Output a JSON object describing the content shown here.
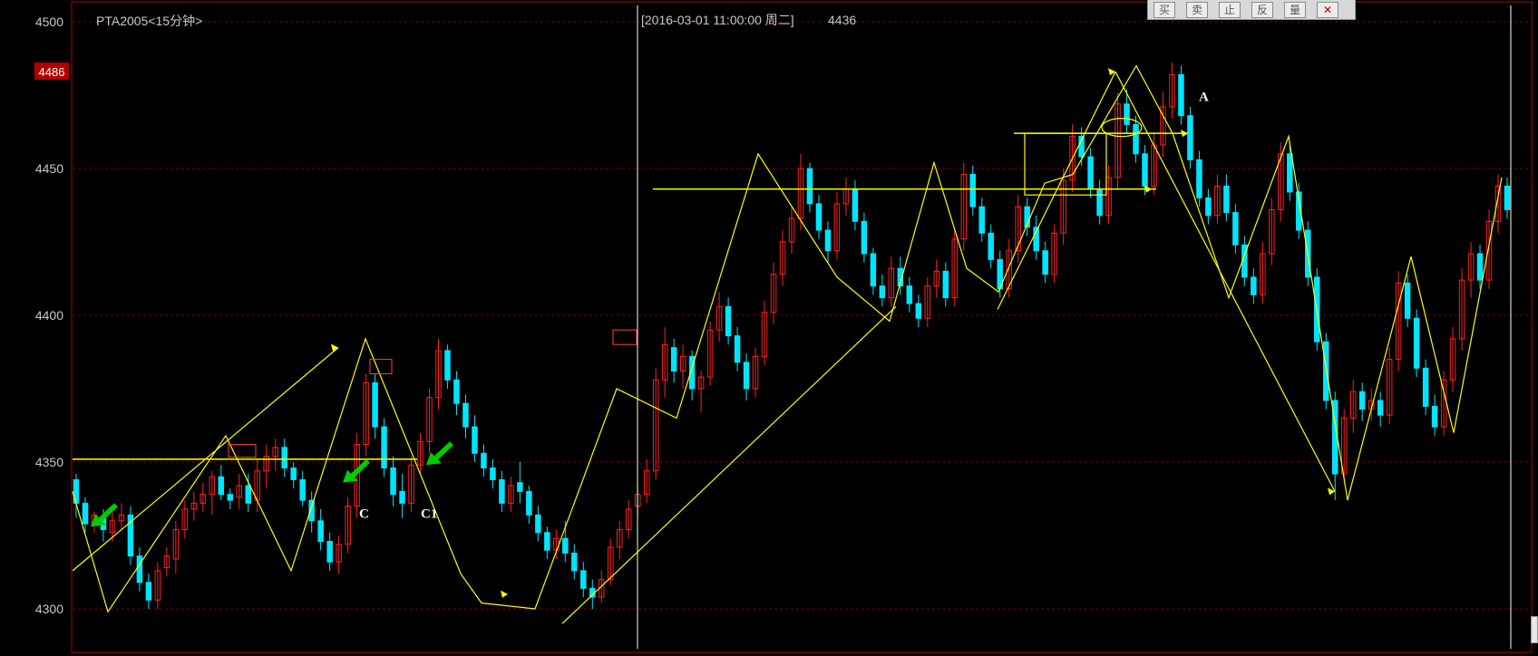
{
  "header": {
    "symbol": "PTA2005<15分钟>",
    "cursor_info": "[2016-03-01  11:00:00 周二]",
    "cursor_value": "4436"
  },
  "current_price_label": "4486",
  "toolbar": {
    "buttons": [
      "买",
      "卖",
      "止",
      "反",
      "量"
    ],
    "close_glyph": "✕"
  },
  "annotations": [
    {
      "text": "C",
      "x": 396,
      "price": 4331
    },
    {
      "text": "C1",
      "x": 464,
      "price": 4331
    },
    {
      "text": "A",
      "x": 1322,
      "price": 4473
    }
  ],
  "colors": {
    "up": "#ff2020",
    "down": "#00e5ff",
    "frame": "#b00000",
    "axis_text": "#c8c8c8",
    "trend": "#ffff00",
    "arrow_green": "#00cc00",
    "price_label_bg": "#b00000"
  },
  "chart_data": {
    "type": "candlestick",
    "title": "PTA2005<15分钟>",
    "ylim": [
      4285,
      4507
    ],
    "yticks": [
      "4500",
      "4450",
      "4400",
      "4350",
      "4300"
    ],
    "grid": "horizontal-dashed",
    "trend_zigzag": [
      [
        80,
        4340
      ],
      [
        119,
        4299
      ],
      [
        249,
        4359
      ],
      [
        321,
        4313
      ],
      [
        403,
        4392
      ],
      [
        508,
        4312
      ],
      [
        531,
        4302
      ],
      [
        590,
        4300
      ],
      [
        680,
        4375
      ],
      [
        746,
        4365
      ],
      [
        836,
        4455
      ],
      [
        923,
        4413
      ],
      [
        981,
        4398
      ],
      [
        1030,
        4452
      ],
      [
        1066,
        4416
      ],
      [
        1101,
        4408
      ],
      [
        1152,
        4445
      ],
      [
        1183,
        4448
      ],
      [
        1253,
        4485
      ],
      [
        1293,
        4462
      ],
      [
        1355,
        4406
      ],
      [
        1421,
        4461
      ],
      [
        1486,
        4337
      ],
      [
        1556,
        4420
      ],
      [
        1603,
        4360
      ],
      [
        1656,
        4447
      ]
    ],
    "support_lines": [
      {
        "from": [
          80,
          4351
        ],
        "to": [
          460,
          4351
        ]
      },
      {
        "from": [
          720,
          4443
        ],
        "to": [
          1275,
          4443
        ]
      },
      {
        "from": [
          1118,
          4462
        ],
        "to": [
          1310,
          4462
        ]
      }
    ],
    "ohlc": [
      [
        4344,
        4346,
        4331,
        4336
      ],
      [
        4336,
        4338,
        4326,
        4329
      ],
      [
        4329,
        4333,
        4326,
        4332
      ],
      [
        4331,
        4334,
        4323,
        4327
      ],
      [
        4326,
        4333,
        4323,
        4330
      ],
      [
        4330,
        4336,
        4327,
        4332
      ],
      [
        4332,
        4335,
        4315,
        4318
      ],
      [
        4318,
        4321,
        4306,
        4309
      ],
      [
        4309,
        4312,
        4300,
        4303
      ],
      [
        4303,
        4316,
        4300,
        4313
      ],
      [
        4314,
        4321,
        4311,
        4318
      ],
      [
        4317,
        4330,
        4312,
        4327
      ],
      [
        4327,
        4337,
        4324,
        4334
      ],
      [
        4334,
        4340,
        4330,
        4336
      ],
      [
        4336,
        4343,
        4333,
        4339
      ],
      [
        4339,
        4347,
        4332,
        4345
      ],
      [
        4345,
        4349,
        4337,
        4339
      ],
      [
        4339,
        4341,
        4334,
        4337
      ],
      [
        4338,
        4346,
        4334,
        4342
      ],
      [
        4342,
        4346,
        4333,
        4336
      ],
      [
        4337,
        4351,
        4333,
        4347
      ],
      [
        4347,
        4356,
        4341,
        4352
      ],
      [
        4352,
        4358,
        4347,
        4355
      ],
      [
        4355,
        4358,
        4345,
        4348
      ],
      [
        4348,
        4350,
        4341,
        4344
      ],
      [
        4344,
        4347,
        4335,
        4337
      ],
      [
        4337,
        4340,
        4326,
        4330
      ],
      [
        4330,
        4334,
        4320,
        4323
      ],
      [
        4323,
        4326,
        4313,
        4316
      ],
      [
        4316,
        4325,
        4312,
        4322
      ],
      [
        4322,
        4338,
        4319,
        4335
      ],
      [
        4335,
        4360,
        4331,
        4356
      ],
      [
        4356,
        4380,
        4352,
        4377
      ],
      [
        4377,
        4380,
        4358,
        4362
      ],
      [
        4362,
        4365,
        4345,
        4348
      ],
      [
        4348,
        4352,
        4335,
        4339
      ],
      [
        4340,
        4346,
        4331,
        4336
      ],
      [
        4336,
        4352,
        4333,
        4349
      ],
      [
        4349,
        4360,
        4346,
        4357
      ],
      [
        4357,
        4375,
        4353,
        4372
      ],
      [
        4372,
        4392,
        4368,
        4388
      ],
      [
        4388,
        4390,
        4375,
        4378
      ],
      [
        4378,
        4381,
        4366,
        4370
      ],
      [
        4370,
        4373,
        4358,
        4362
      ],
      [
        4362,
        4366,
        4350,
        4353
      ],
      [
        4353,
        4356,
        4345,
        4348
      ],
      [
        4348,
        4351,
        4341,
        4344
      ],
      [
        4344,
        4347,
        4333,
        4336
      ],
      [
        4336,
        4345,
        4333,
        4342
      ],
      [
        4343,
        4350,
        4336,
        4340
      ],
      [
        4340,
        4342,
        4329,
        4332
      ],
      [
        4332,
        4335,
        4323,
        4326
      ],
      [
        4326,
        4328,
        4317,
        4320
      ],
      [
        4320,
        4327,
        4317,
        4324
      ],
      [
        4324,
        4330,
        4316,
        4319
      ],
      [
        4319,
        4322,
        4310,
        4313
      ],
      [
        4313,
        4316,
        4304,
        4307
      ],
      [
        4307,
        4310,
        4300,
        4304
      ],
      [
        4304,
        4313,
        4302,
        4310
      ],
      [
        4310,
        4324,
        4308,
        4321
      ],
      [
        4321,
        4330,
        4317,
        4327
      ],
      [
        4327,
        4337,
        4324,
        4334
      ],
      [
        4335,
        4342,
        4331,
        4339
      ],
      [
        4339,
        4351,
        4336,
        4347
      ],
      [
        4347,
        4382,
        4344,
        4378
      ],
      [
        4378,
        4396,
        4372,
        4390
      ],
      [
        4389,
        4392,
        4377,
        4381
      ],
      [
        4381,
        4390,
        4375,
        4386
      ],
      [
        4386,
        4388,
        4371,
        4375
      ],
      [
        4375,
        4381,
        4367,
        4379
      ],
      [
        4379,
        4398,
        4376,
        4395
      ],
      [
        4395,
        4408,
        4391,
        4403
      ],
      [
        4403,
        4406,
        4390,
        4393
      ],
      [
        4393,
        4396,
        4381,
        4384
      ],
      [
        4384,
        4387,
        4371,
        4375
      ],
      [
        4375,
        4389,
        4372,
        4386
      ],
      [
        4386,
        4405,
        4383,
        4401
      ],
      [
        4401,
        4418,
        4397,
        4414
      ],
      [
        4414,
        4429,
        4410,
        4425
      ],
      [
        4425,
        4437,
        4421,
        4433
      ],
      [
        4433,
        4455,
        4429,
        4450
      ],
      [
        4450,
        4452,
        4435,
        4438
      ],
      [
        4438,
        4441,
        4426,
        4429
      ],
      [
        4429,
        4432,
        4418,
        4422
      ],
      [
        4422,
        4442,
        4419,
        4438
      ],
      [
        4438,
        4447,
        4434,
        4443
      ],
      [
        4443,
        4446,
        4429,
        4432
      ],
      [
        4432,
        4435,
        4418,
        4421
      ],
      [
        4421,
        4423,
        4407,
        4410
      ],
      [
        4410,
        4414,
        4403,
        4406
      ],
      [
        4406,
        4420,
        4403,
        4416
      ],
      [
        4416,
        4420,
        4407,
        4410
      ],
      [
        4410,
        4413,
        4401,
        4404
      ],
      [
        4404,
        4407,
        4396,
        4399
      ],
      [
        4399,
        4413,
        4396,
        4410
      ],
      [
        4410,
        4419,
        4406,
        4415
      ],
      [
        4415,
        4418,
        4403,
        4406
      ],
      [
        4406,
        4430,
        4403,
        4426
      ],
      [
        4426,
        4452,
        4422,
        4448
      ],
      [
        4448,
        4451,
        4434,
        4437
      ],
      [
        4437,
        4440,
        4425,
        4428
      ],
      [
        4428,
        4431,
        4416,
        4419
      ],
      [
        4419,
        4422,
        4406,
        4409
      ],
      [
        4409,
        4426,
        4406,
        4422
      ],
      [
        4422,
        4441,
        4418,
        4437
      ],
      [
        4437,
        4440,
        4427,
        4430
      ],
      [
        4430,
        4434,
        4419,
        4422
      ],
      [
        4422,
        4425,
        4411,
        4414
      ],
      [
        4414,
        4431,
        4411,
        4428
      ],
      [
        4428,
        4450,
        4424,
        4446
      ],
      [
        4446,
        4465,
        4442,
        4461
      ],
      [
        4461,
        4464,
        4451,
        4454
      ],
      [
        4454,
        4457,
        4440,
        4443
      ],
      [
        4443,
        4446,
        4431,
        4434
      ],
      [
        4434,
        4451,
        4431,
        4447
      ],
      [
        4447,
        4476,
        4443,
        4472
      ],
      [
        4472,
        4477,
        4462,
        4465
      ],
      [
        4465,
        4468,
        4452,
        4455
      ],
      [
        4455,
        4458,
        4441,
        4444
      ],
      [
        4444,
        4462,
        4441,
        4458
      ],
      [
        4458,
        4476,
        4454,
        4471
      ],
      [
        4471,
        4486,
        4467,
        4482
      ],
      [
        4482,
        4485,
        4465,
        4468
      ],
      [
        4468,
        4471,
        4450,
        4453
      ],
      [
        4453,
        4456,
        4437,
        4440
      ],
      [
        4440,
        4443,
        4431,
        4434
      ],
      [
        4434,
        4448,
        4431,
        4444
      ],
      [
        4444,
        4448,
        4432,
        4435
      ],
      [
        4435,
        4438,
        4421,
        4424
      ],
      [
        4424,
        4427,
        4410,
        4413
      ],
      [
        4413,
        4416,
        4404,
        4407
      ],
      [
        4407,
        4425,
        4404,
        4421
      ],
      [
        4421,
        4440,
        4417,
        4436
      ],
      [
        4436,
        4459,
        4432,
        4455
      ],
      [
        4455,
        4458,
        4439,
        4442
      ],
      [
        4442,
        4445,
        4426,
        4429
      ],
      [
        4429,
        4432,
        4410,
        4413
      ],
      [
        4413,
        4416,
        4388,
        4391
      ],
      [
        4391,
        4394,
        4368,
        4371
      ],
      [
        4371,
        4374,
        4337,
        4346
      ],
      [
        4346,
        4368,
        4343,
        4365
      ],
      [
        4365,
        4378,
        4360,
        4374
      ],
      [
        4374,
        4377,
        4364,
        4368
      ],
      [
        4368,
        4375,
        4364,
        4371
      ],
      [
        4371,
        4374,
        4362,
        4366
      ],
      [
        4366,
        4389,
        4363,
        4385
      ],
      [
        4385,
        4415,
        4381,
        4411
      ],
      [
        4411,
        4414,
        4396,
        4399
      ],
      [
        4399,
        4402,
        4379,
        4382
      ],
      [
        4382,
        4385,
        4366,
        4369
      ],
      [
        4369,
        4373,
        4359,
        4362
      ],
      [
        4362,
        4381,
        4359,
        4378
      ],
      [
        4378,
        4396,
        4374,
        4392
      ],
      [
        4392,
        4416,
        4388,
        4412
      ],
      [
        4412,
        4425,
        4406,
        4421
      ],
      [
        4421,
        4424,
        4409,
        4412
      ],
      [
        4412,
        4436,
        4409,
        4432
      ],
      [
        4432,
        4448,
        4428,
        4444
      ],
      [
        4444,
        4447,
        4433,
        4436
      ]
    ]
  }
}
